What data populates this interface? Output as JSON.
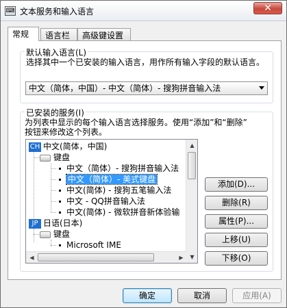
{
  "window": {
    "title": "文本服务和输入语言",
    "title_icon": "keyboard-icon",
    "close_glyph": "✕"
  },
  "tabs": [
    {
      "label": "常规"
    },
    {
      "label": "语言栏"
    },
    {
      "label": "高级键设置"
    }
  ],
  "default_lang": {
    "group_label": "默认输入语言(L)",
    "description": "选择其中一个已安装的输入语言，用作所有输入字段的默认语言。",
    "selected": "中文（简体，中国）- 中文（简体）- 搜狗拼音输入法"
  },
  "installed": {
    "group_label": "已安装的服务(I)",
    "description_line1": "为列表中显示的每个输入语言选择服务。使用“添加”和“删除”",
    "description_line2": "按钮来修改这个列表。",
    "tree": {
      "lang1": {
        "badge": "CH",
        "label": "中文(简体，中国)"
      },
      "lang1_keyboard": "键盘",
      "lang1_items": [
        "中文（简体）- 搜狗拼音输入法",
        "中文（简体）- 美式键盘",
        "中文(简体) - 搜狗五笔输入法",
        "中文 - QQ拼音输入法",
        "中文(简体) - 微软拼音新体验输"
      ],
      "lang2": {
        "badge": "JP",
        "label": "日语(日本)"
      },
      "lang2_keyboard": "键盘",
      "lang2_items": [
        "Microsoft IME"
      ]
    }
  },
  "side_buttons": {
    "add": "添加(D)...",
    "remove": "删除(R)",
    "properties": "属性(P)...",
    "move_up": "上移(U)",
    "move_down": "下移(O)"
  },
  "footer": {
    "ok": "确定",
    "cancel": "取消",
    "apply": "应用(A)"
  },
  "colors": {
    "selection": "#3399ff",
    "lang_badge": "#1f6fd1",
    "close_button": "#c8483c"
  }
}
